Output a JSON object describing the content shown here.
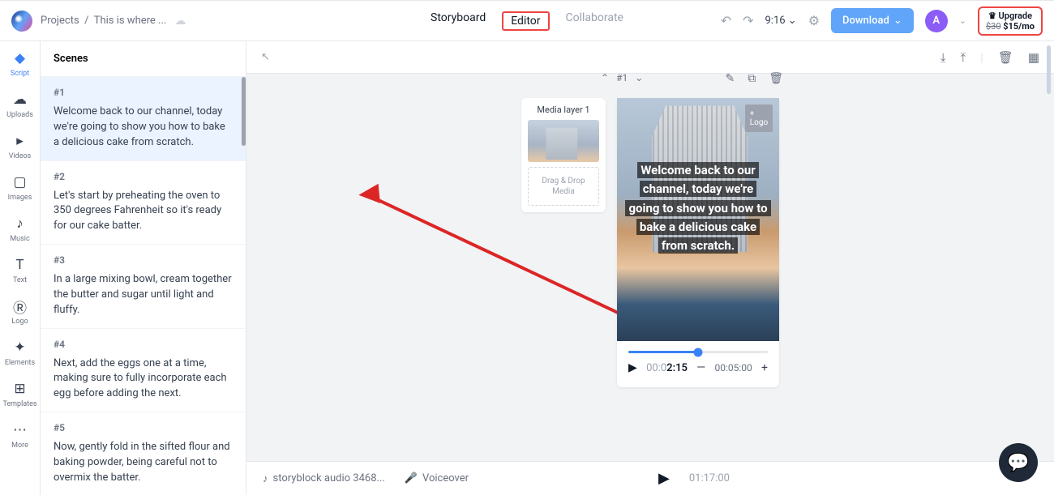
{
  "breadcrumb": {
    "root": "Projects",
    "current": "This is where ..."
  },
  "tabs": {
    "storyboard": "Storyboard",
    "editor": "Editor",
    "collaborate": "Collaborate"
  },
  "time_display": "9:16",
  "download_label": "Download",
  "avatar_letter": "A",
  "upgrade": {
    "label": "Upgrade",
    "strike": "$30",
    "price": "$15/mo"
  },
  "rail": {
    "script": "Script",
    "uploads": "Uploads",
    "videos": "Videos",
    "images": "Images",
    "music": "Music",
    "text": "Text",
    "logo": "Logo",
    "elements": "Elements",
    "templates": "Templates",
    "more": "More"
  },
  "scenes_header": "Scenes",
  "scenes": [
    {
      "num": "#1",
      "text": "Welcome back to our channel, today we're going to show you how to bake a delicious cake from scratch."
    },
    {
      "num": "#2",
      "text": "Let's start by preheating the oven to 350 degrees Fahrenheit so it's ready for our cake batter."
    },
    {
      "num": "#3",
      "text": "In a large mixing bowl, cream together the butter and sugar until light and fluffy."
    },
    {
      "num": "#4",
      "text": "Next, add the eggs one at a time, making sure to fully incorporate each egg before adding the next."
    },
    {
      "num": "#5",
      "text": "Now, gently fold in the sifted flour and baking powder, being careful not to overmix the batter."
    }
  ],
  "media": {
    "title": "Media layer 1",
    "drop": "Drag & Drop\nMedia"
  },
  "stage": {
    "scene_label": "#1",
    "logo_ph": "+\nLogo",
    "overlay": "Welcome back to our channel, today we're going to show you how to bake a delicious cake from scratch.",
    "current_gray": "00:0",
    "current_bold": "2:15",
    "total": "00:05:00"
  },
  "bottom": {
    "audio": "storyblock audio 3468...",
    "voiceover": "Voiceover",
    "total": "01:17:00"
  }
}
